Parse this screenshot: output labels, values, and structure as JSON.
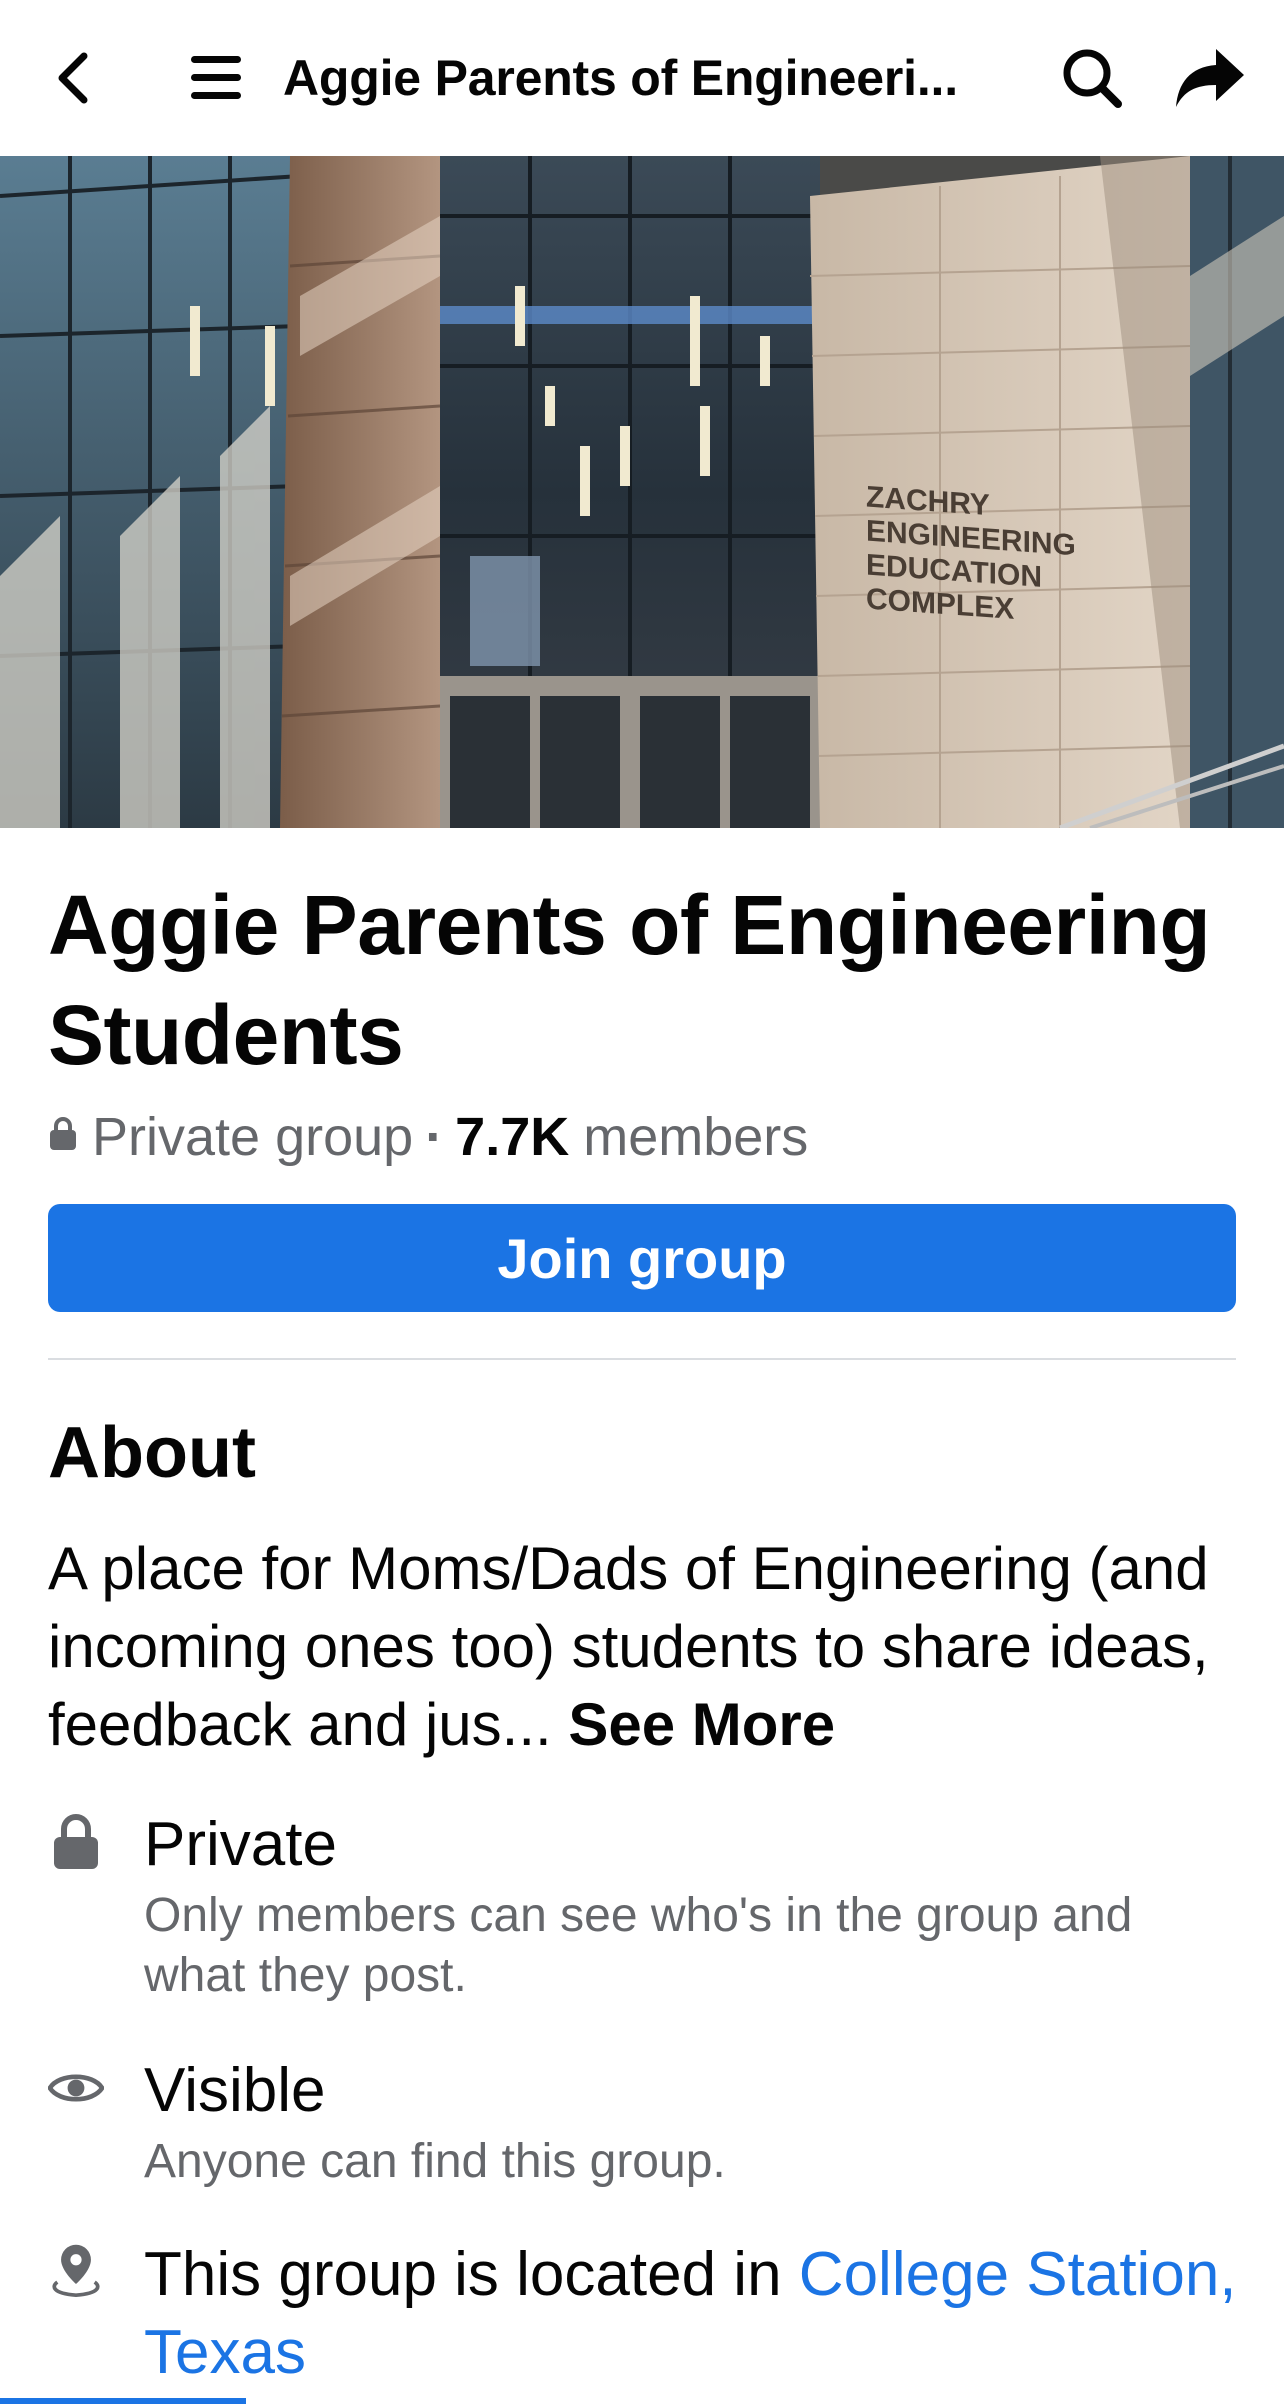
{
  "topbar": {
    "title": "Aggie Parents of Engineeri...",
    "back_icon": "chevron-left-icon",
    "menu_icon": "hamburger-menu-icon",
    "search_icon": "search-icon",
    "share_icon": "share-arrow-icon"
  },
  "cover": {
    "sign_lines": [
      "ZACHRY",
      "ENGINEERING",
      "EDUCATION",
      "COMPLEX"
    ]
  },
  "group": {
    "name": "Aggie Parents of Engineering Students",
    "privacy": "Private group",
    "separator": "·",
    "member_count": "7.7K",
    "member_label": "members",
    "join_label": "Join group"
  },
  "about": {
    "title": "About",
    "description": "A place for Moms/Dads of Engineering (and incoming ones too) students to share ideas, feedback and jus...",
    "see_more": "See More",
    "items": [
      {
        "icon": "lock-icon",
        "title": "Private",
        "subtitle": "Only members can see who's in the group and what they post."
      },
      {
        "icon": "eye-icon",
        "title": "Visible",
        "subtitle": "Anyone can find this group."
      },
      {
        "icon": "location-pin-icon",
        "title": "This group is located in",
        "link": "College Station, Texas"
      }
    ]
  },
  "colors": {
    "accent": "#1b74e4",
    "secondary_text": "#65676b",
    "primary_text": "#050505"
  }
}
